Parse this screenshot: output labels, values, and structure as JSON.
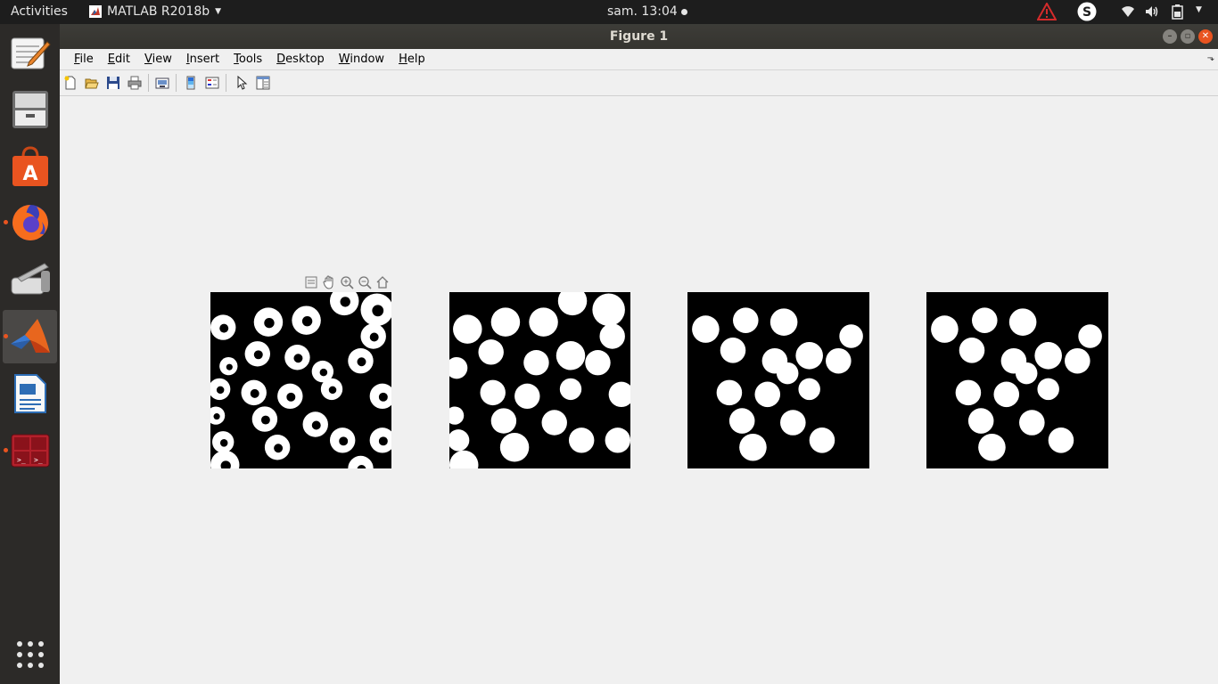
{
  "topbar": {
    "activities": "Activities",
    "app_name": "MATLAB R2018b",
    "clock": "sam. 13:04",
    "tray_icons": [
      "warning-icon",
      "skype-icon",
      "wifi-icon",
      "volume-icon",
      "battery-icon",
      "system-menu-icon"
    ]
  },
  "dock": {
    "items": [
      {
        "name": "text-editor",
        "icon": "text-editor-icon",
        "running": false
      },
      {
        "name": "files",
        "icon": "file-cabinet-icon",
        "running": false
      },
      {
        "name": "software-center",
        "icon": "shopping-bag-icon",
        "running": false
      },
      {
        "name": "firefox",
        "icon": "firefox-icon",
        "running": true
      },
      {
        "name": "scanner",
        "icon": "scanner-icon",
        "running": false
      },
      {
        "name": "matlab",
        "icon": "matlab-icon",
        "running": true,
        "active": true
      },
      {
        "name": "writer",
        "icon": "document-icon",
        "running": false
      },
      {
        "name": "terminal",
        "icon": "terminal-icon",
        "running": true
      }
    ],
    "show_apps_icon": "app-grid-icon"
  },
  "window": {
    "title": "Figure 1",
    "menus": [
      {
        "pre": "",
        "u": "F",
        "post": "ile"
      },
      {
        "pre": "",
        "u": "E",
        "post": "dit"
      },
      {
        "pre": "",
        "u": "V",
        "post": "iew"
      },
      {
        "pre": "",
        "u": "I",
        "post": "nsert"
      },
      {
        "pre": "",
        "u": "T",
        "post": "ools"
      },
      {
        "pre": "",
        "u": "D",
        "post": "esktop"
      },
      {
        "pre": "",
        "u": "W",
        "post": "indow"
      },
      {
        "pre": "",
        "u": "H",
        "post": "elp"
      }
    ],
    "toolbar_icons": [
      "new-figure-icon",
      "open-icon",
      "save-icon",
      "print-icon",
      "link-plot-icon",
      "colorbar-icon",
      "legend-icon",
      "edit-plot-icon",
      "property-inspector-icon"
    ],
    "axes_toolbar_icons": [
      "data-tips-icon",
      "pan-icon",
      "zoom-in-icon",
      "zoom-out-icon",
      "restore-view-icon"
    ]
  },
  "figure": {
    "subplots": [
      {
        "name": "binary-image-1",
        "blobs": [
          [
            0.07,
            0.2,
            0.07
          ],
          [
            0.32,
            0.17,
            0.08
          ],
          [
            0.53,
            0.16,
            0.08
          ],
          [
            0.74,
            0.05,
            0.08
          ],
          [
            0.92,
            0.1,
            0.09
          ],
          [
            0.9,
            0.25,
            0.07
          ],
          [
            0.1,
            0.42,
            0.05
          ],
          [
            0.26,
            0.35,
            0.07
          ],
          [
            0.48,
            0.37,
            0.07
          ],
          [
            0.62,
            0.45,
            0.06
          ],
          [
            0.83,
            0.39,
            0.07
          ],
          [
            0.05,
            0.55,
            0.06
          ],
          [
            0.24,
            0.57,
            0.07
          ],
          [
            0.44,
            0.59,
            0.07
          ],
          [
            0.67,
            0.55,
            0.06
          ],
          [
            0.95,
            0.59,
            0.07
          ],
          [
            0.3,
            0.72,
            0.07
          ],
          [
            0.58,
            0.75,
            0.07
          ],
          [
            0.03,
            0.7,
            0.05
          ],
          [
            0.07,
            0.85,
            0.06
          ],
          [
            0.37,
            0.88,
            0.07
          ],
          [
            0.73,
            0.84,
            0.07
          ],
          [
            0.95,
            0.84,
            0.07
          ],
          [
            0.08,
            0.98,
            0.08
          ],
          [
            0.83,
            1.0,
            0.07
          ]
        ],
        "ring": true
      },
      {
        "name": "binary-image-2",
        "blobs": [
          [
            0.1,
            0.21,
            0.08
          ],
          [
            0.31,
            0.17,
            0.08
          ],
          [
            0.52,
            0.17,
            0.08
          ],
          [
            0.68,
            0.05,
            0.08
          ],
          [
            0.88,
            0.1,
            0.09
          ],
          [
            0.9,
            0.25,
            0.07
          ],
          [
            0.23,
            0.34,
            0.07
          ],
          [
            0.48,
            0.4,
            0.07
          ],
          [
            0.67,
            0.36,
            0.08
          ],
          [
            0.82,
            0.4,
            0.07
          ],
          [
            0.04,
            0.43,
            0.06
          ],
          [
            0.24,
            0.57,
            0.07
          ],
          [
            0.43,
            0.59,
            0.07
          ],
          [
            0.67,
            0.55,
            0.06
          ],
          [
            0.95,
            0.58,
            0.07
          ],
          [
            0.3,
            0.73,
            0.07
          ],
          [
            0.58,
            0.74,
            0.07
          ],
          [
            0.03,
            0.7,
            0.05
          ],
          [
            0.05,
            0.84,
            0.06
          ],
          [
            0.36,
            0.88,
            0.08
          ],
          [
            0.73,
            0.84,
            0.07
          ],
          [
            0.93,
            0.84,
            0.07
          ],
          [
            0.08,
            0.98,
            0.08
          ]
        ],
        "ring": false
      },
      {
        "name": "binary-image-3",
        "blobs": [
          [
            0.1,
            0.21,
            0.075
          ],
          [
            0.32,
            0.16,
            0.07
          ],
          [
            0.53,
            0.17,
            0.075
          ],
          [
            0.9,
            0.25,
            0.065
          ],
          [
            0.25,
            0.33,
            0.07
          ],
          [
            0.48,
            0.39,
            0.07
          ],
          [
            0.67,
            0.36,
            0.075
          ],
          [
            0.83,
            0.39,
            0.07
          ],
          [
            0.55,
            0.46,
            0.06
          ],
          [
            0.23,
            0.57,
            0.07
          ],
          [
            0.44,
            0.58,
            0.07
          ],
          [
            0.67,
            0.55,
            0.06
          ],
          [
            0.3,
            0.73,
            0.07
          ],
          [
            0.58,
            0.74,
            0.07
          ],
          [
            0.36,
            0.88,
            0.075
          ],
          [
            0.74,
            0.84,
            0.07
          ]
        ],
        "ring": false
      },
      {
        "name": "binary-image-4",
        "blobs": [
          [
            0.1,
            0.21,
            0.075
          ],
          [
            0.32,
            0.16,
            0.07
          ],
          [
            0.53,
            0.17,
            0.075
          ],
          [
            0.9,
            0.25,
            0.065
          ],
          [
            0.25,
            0.33,
            0.07
          ],
          [
            0.48,
            0.39,
            0.07
          ],
          [
            0.67,
            0.36,
            0.075
          ],
          [
            0.83,
            0.39,
            0.07
          ],
          [
            0.55,
            0.46,
            0.06
          ],
          [
            0.23,
            0.57,
            0.07
          ],
          [
            0.44,
            0.58,
            0.07
          ],
          [
            0.67,
            0.55,
            0.06
          ],
          [
            0.3,
            0.73,
            0.07
          ],
          [
            0.58,
            0.74,
            0.07
          ],
          [
            0.36,
            0.88,
            0.075
          ],
          [
            0.74,
            0.84,
            0.07
          ]
        ],
        "ring": false
      }
    ]
  }
}
